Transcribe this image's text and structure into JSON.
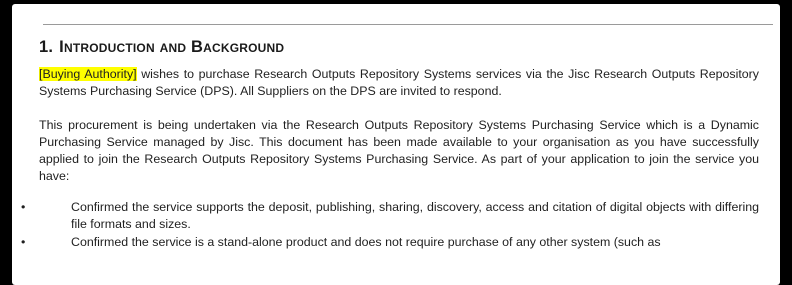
{
  "section": {
    "number": "1.",
    "title": "Introduction and Background"
  },
  "paragraph1": {
    "highlight": "[Buying Authority]",
    "text": " wishes to purchase Research Outputs Repository Systems services via the Jisc Research Outputs Repository Systems Purchasing Service (DPS). All Suppliers on the DPS are invited to respond."
  },
  "paragraph2": "This procurement is being undertaken via the Research Outputs Repository Systems Purchasing Service which is a Dynamic Purchasing Service managed by Jisc. This document has been made available to your organisation as you have successfully applied to join the Research Outputs Repository Systems Purchasing Service. As part of your application to join the service you have:",
  "bullets": [
    "Confirmed the service supports the deposit, publishing, sharing, discovery, access and citation of digital objects with differing file formats and sizes.",
    "Confirmed the service is a stand-alone product and does not require purchase of any other system (such as"
  ],
  "bullet_glyph": "•",
  "colors": {
    "highlight": "#ffff00",
    "frame": "#000000"
  }
}
